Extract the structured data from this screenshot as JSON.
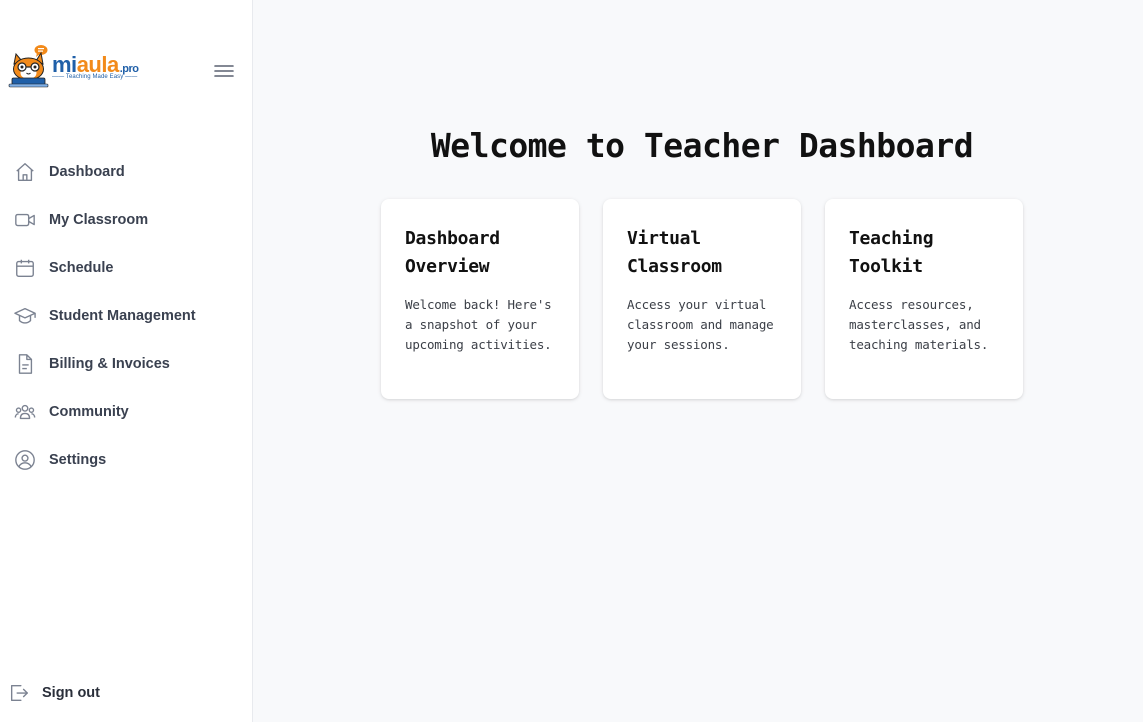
{
  "brand": {
    "name_part1": "mi",
    "name_part2": "aula",
    "name_suffix": ".pro",
    "tagline": "—— Teaching Made Easy ——",
    "primary_color": "#1f5fa8",
    "accent_color": "#f28a1a"
  },
  "sidebar": {
    "menu_toggle_icon": "hamburger-icon",
    "items": [
      {
        "label": "Dashboard",
        "icon": "home-icon"
      },
      {
        "label": "My Classroom",
        "icon": "video-camera-icon"
      },
      {
        "label": "Schedule",
        "icon": "calendar-icon"
      },
      {
        "label": "Student Management",
        "icon": "graduation-cap-icon"
      },
      {
        "label": "Billing & Invoices",
        "icon": "document-icon"
      },
      {
        "label": "Community",
        "icon": "users-icon"
      },
      {
        "label": "Settings",
        "icon": "user-circle-icon"
      }
    ],
    "signout": {
      "label": "Sign out",
      "icon": "sign-out-icon"
    }
  },
  "main": {
    "title": "Welcome to Teacher Dashboard",
    "cards": [
      {
        "title_line1": "Dashboard",
        "title_line2": "Overview",
        "description": "Welcome back! Here's a snapshot of your upcoming activities."
      },
      {
        "title_line1": "Virtual",
        "title_line2": "Classroom",
        "description": "Access your virtual classroom and manage your sessions."
      },
      {
        "title_line1": "Teaching",
        "title_line2": "Toolkit",
        "description": "Access resources, masterclasses, and teaching materials."
      }
    ]
  }
}
